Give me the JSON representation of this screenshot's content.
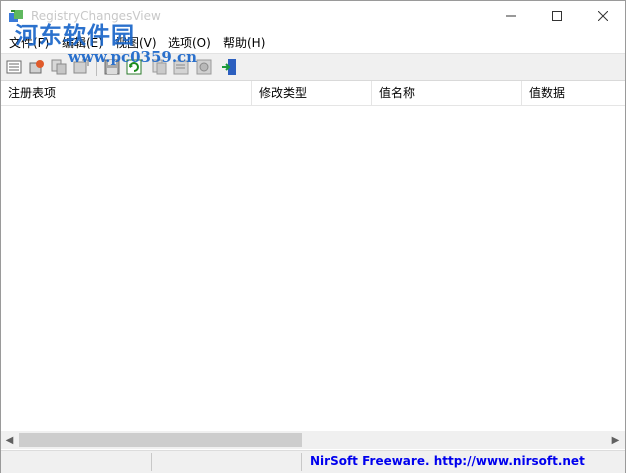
{
  "window": {
    "title": "RegistryChangesView",
    "controls": {
      "minimize": "minimize",
      "maximize": "maximize",
      "close": "close"
    }
  },
  "watermark": {
    "logo_text": "河东软件园",
    "url_text": "www.pc0359.cn"
  },
  "menubar": {
    "items": [
      {
        "label": "文件(F)"
      },
      {
        "label": "编辑(E)"
      },
      {
        "label": "视图(V)"
      },
      {
        "label": "选项(O)"
      },
      {
        "label": "帮助(H)"
      }
    ]
  },
  "toolbar": {
    "buttons": [
      {
        "icon": "list-options-icon"
      },
      {
        "icon": "open-snapshot-icon"
      },
      {
        "icon": "copy-icon"
      },
      {
        "icon": "compare-icon"
      },
      {
        "icon": "save-icon"
      },
      {
        "icon": "refresh-icon"
      },
      {
        "icon": "copy-selected-icon"
      },
      {
        "icon": "properties-icon"
      },
      {
        "icon": "html-report-icon"
      },
      {
        "icon": "exit-icon"
      }
    ]
  },
  "table": {
    "columns": [
      "注册表项",
      "修改类型",
      "值名称",
      "值数据"
    ],
    "rows": []
  },
  "statusbar": {
    "link_text": "NirSoft Freeware.  http://www.nirsoft.net"
  },
  "colors": {
    "watermark_blue": "#1a66c9",
    "link_blue": "#0000ee",
    "toolbar_bg": "#f0f0f0"
  }
}
